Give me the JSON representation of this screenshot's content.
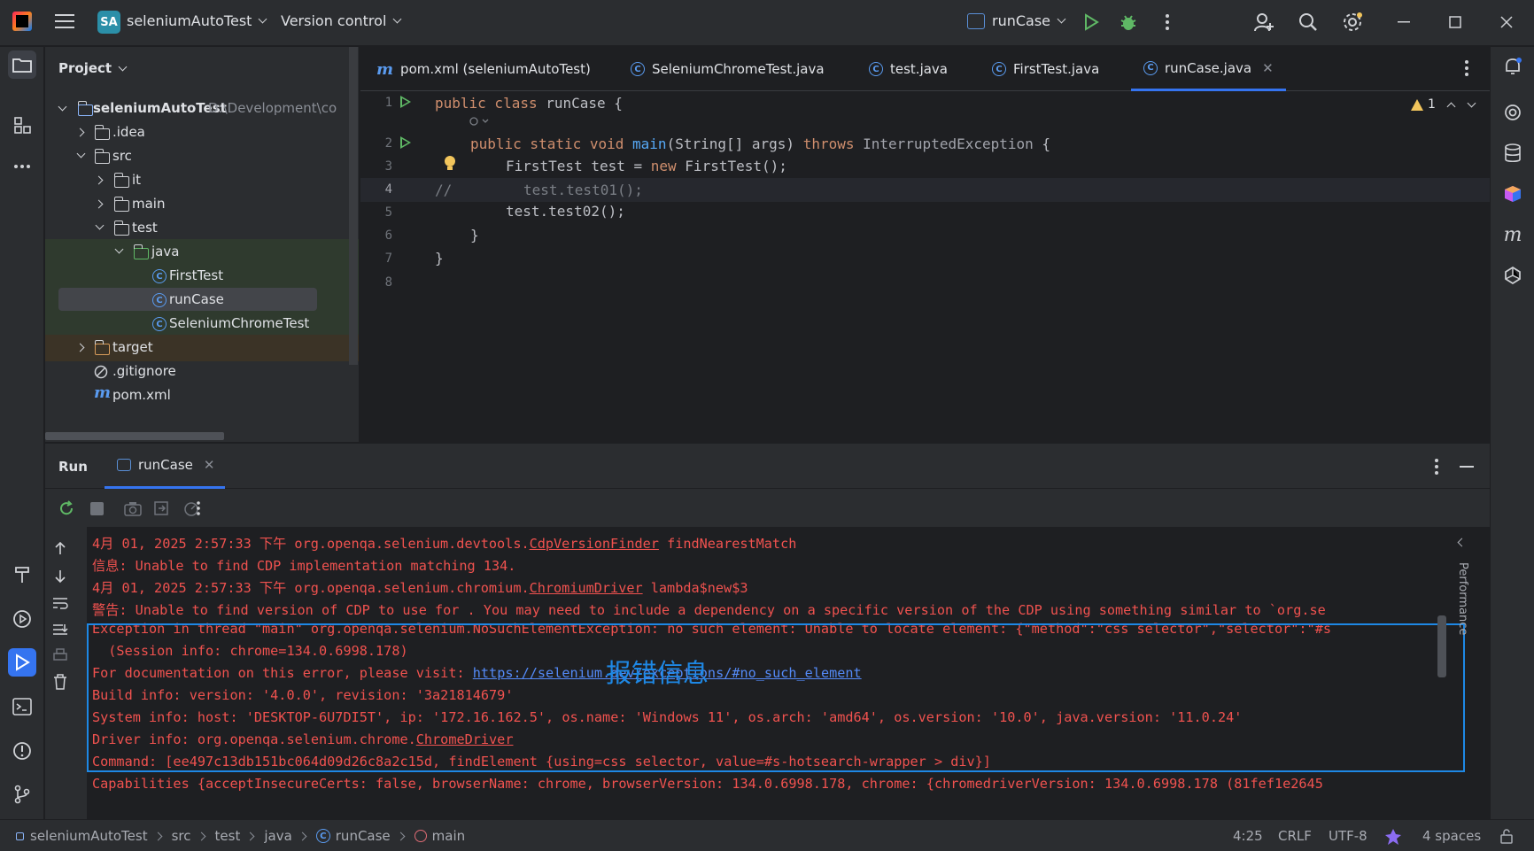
{
  "titlebar": {
    "project_badge": "SA",
    "project_name": "seleniumAutoTest",
    "version_control": "Version control",
    "run_config": "runCase"
  },
  "project_panel": {
    "title": "Project",
    "tree": [
      {
        "label": "seleniumAutoTest",
        "path": "D:\\Development\\co"
      },
      {
        "label": ".idea"
      },
      {
        "label": "src"
      },
      {
        "label": "it"
      },
      {
        "label": "main"
      },
      {
        "label": "test"
      },
      {
        "label": "java"
      },
      {
        "label": "FirstTest"
      },
      {
        "label": "runCase"
      },
      {
        "label": "SeleniumChromeTest"
      },
      {
        "label": "target"
      },
      {
        "label": ".gitignore"
      },
      {
        "label": "pom.xml"
      }
    ]
  },
  "editor": {
    "tabs": [
      {
        "label": "pom.xml (seleniumAutoTest)",
        "icon": "maven-icon"
      },
      {
        "label": "SeleniumChromeTest.java",
        "icon": "class-icon"
      },
      {
        "label": "test.java",
        "icon": "class-icon"
      },
      {
        "label": "FirstTest.java",
        "icon": "class-icon"
      },
      {
        "label": "runCase.java",
        "icon": "class-icon",
        "active": true
      }
    ],
    "warning_count": "1",
    "line_numbers": [
      "1",
      "2",
      "3",
      "4",
      "5",
      "6",
      "7",
      "8"
    ],
    "code": {
      "l1_kw": "public class ",
      "l1_rest": "runCase {",
      "l2_kw": "public static void ",
      "l2_fn": "main",
      "l2_args": "(String[] args) ",
      "l2_throws": "throws ",
      "l2_type": "InterruptedException",
      "l2_end": " {",
      "l3_a": "FirstTest test = ",
      "l3_kw": "new ",
      "l3_b": "FirstTest();",
      "l4_cm1": "//",
      "l4_cm2": "test.test01();",
      "l5": "test.test02();",
      "l6": "}",
      "l7": "}"
    }
  },
  "run_panel": {
    "title": "Run",
    "tab_label": "runCase",
    "console_lines": [
      {
        "pre": "4月 01, 2025 2:57:33 下午 org.openqa.selenium.devtools.",
        "ul": "CdpVersionFinder",
        "post": " findNearestMatch"
      },
      {
        "pre": "信息: Unable to find CDP implementation matching 134."
      },
      {
        "pre": "4月 01, 2025 2:57:33 下午 org.openqa.selenium.chromium.",
        "ul": "ChromiumDriver",
        "post": " lambda$new$3"
      },
      {
        "pre": "警告: Unable to find version of CDP to use for . You may need to include a dependency on a specific version of the CDP using something similar to `org.se"
      },
      {
        "pre": "Exception in thread \"main\" org.openqa.selenium.NoSuchElementException: no such element: Unable to locate element: {\"method\":\"css selector\",\"selector\":\"#s"
      },
      {
        "pre": "  (Session info: chrome=134.0.6998.178)"
      },
      {
        "pre": "For documentation on this error, please visit: ",
        "link": "https://selenium.dev/exceptions/#no_such_element"
      },
      {
        "pre": "Build info: version: '4.0.0', revision: '3a21814679'"
      },
      {
        "pre": "System info: host: 'DESKTOP-6U7DI5T', ip: '172.16.162.5', os.name: 'Windows 11', os.arch: 'amd64', os.version: '10.0', java.version: '11.0.24'"
      },
      {
        "pre": "Driver info: org.openqa.selenium.chrome.",
        "ul": "ChromeDriver"
      },
      {
        "pre": "Command: [ee497c13db151bc064d09d26c8a2c15d, findElement {using=css selector, value=#s-hotsearch-wrapper > div}]"
      },
      {
        "pre": "Capabilities {acceptInsecureCerts: false, browserName: chrome, browserVersion: 134.0.6998.178, chrome: {chromedriverVersion: 134.0.6998.178 (81fef1e2645"
      }
    ],
    "annotation": "报错信息",
    "side_label": "Performance"
  },
  "statusbar": {
    "breadcrumbs": [
      "seleniumAutoTest",
      "src",
      "test",
      "java",
      "runCase",
      "main"
    ],
    "position": "4:25",
    "line_ending": "CRLF",
    "encoding": "UTF-8",
    "indent": "4 spaces"
  }
}
